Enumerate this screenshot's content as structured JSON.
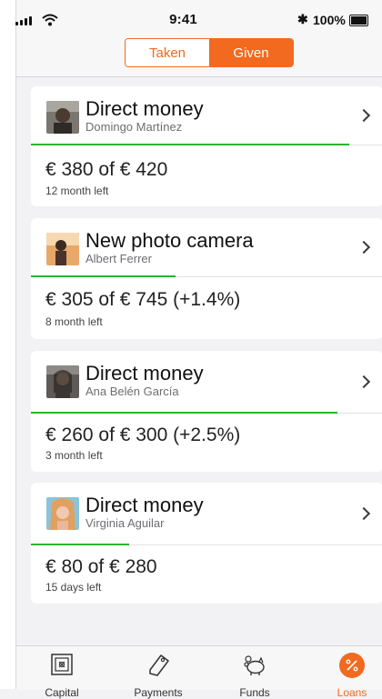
{
  "status_bar": {
    "time": "9:41",
    "battery": "100%"
  },
  "segmented": {
    "taken": "Taken",
    "given": "Given"
  },
  "loans": [
    {
      "title": "Direct money",
      "person": "Domingo Martínez",
      "amount": "€ 380 of € 420",
      "remaining": "12 month left",
      "progress": 0.905
    },
    {
      "title": "New photo camera",
      "person": "Albert Ferrer",
      "amount": "€ 305 of € 745 (+1.4%)",
      "remaining": "8 month left",
      "progress": 0.41
    },
    {
      "title": "Direct money",
      "person": "Ana Belén García",
      "amount": "€ 260 of € 300 (+2.5%)",
      "remaining": "3 month left",
      "progress": 0.87
    },
    {
      "title": "Direct money",
      "person": "Virginia Aguilar",
      "amount": "€ 80 of € 280",
      "remaining": "15 days left",
      "progress": 0.28
    }
  ],
  "tabs": {
    "capital": "Capital",
    "payments": "Payments",
    "funds": "Funds",
    "loans": "Loans"
  },
  "colors": {
    "accent": "#f26a1f",
    "progress": "#2bb52f"
  }
}
